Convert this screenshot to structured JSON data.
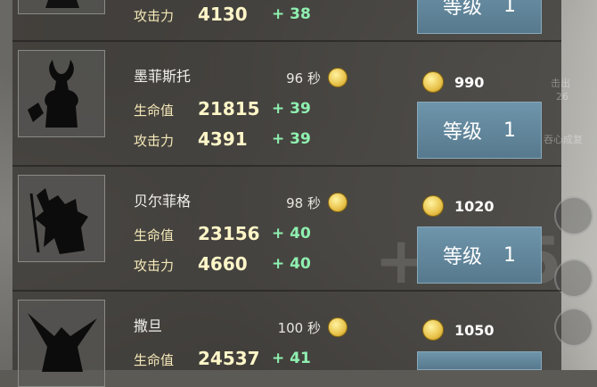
{
  "colors": {
    "panel": "#3a3834",
    "stat_value": "#fff6c8",
    "stat_plus": "#8ff0b0",
    "button": "#6e95ab"
  },
  "rows": [
    {
      "name": "",
      "time": "",
      "cost": "",
      "hp_label": "",
      "hp_value": "",
      "hp_plus": "",
      "atk_label": "攻击力",
      "atk_value": "4130",
      "atk_plus": "+ 38",
      "level_label": "等级",
      "level_value": "1"
    },
    {
      "name": "墨菲斯托",
      "time": "96 秒",
      "cost": "990",
      "hp_label": "生命值",
      "hp_value": "21815",
      "hp_plus": "+ 39",
      "atk_label": "攻击力",
      "atk_value": "4391",
      "atk_plus": "+ 39",
      "level_label": "等级",
      "level_value": "1"
    },
    {
      "name": "贝尔菲格",
      "time": "98 秒",
      "cost": "1020",
      "hp_label": "生命值",
      "hp_value": "23156",
      "hp_plus": "+ 40",
      "atk_label": "攻击力",
      "atk_value": "4660",
      "atk_plus": "+ 40",
      "level_label": "等级",
      "level_value": "1"
    },
    {
      "name": "撒旦",
      "time": "100 秒",
      "cost": "1050",
      "hp_label": "生命值",
      "hp_value": "24537",
      "hp_plus": "+ 41",
      "atk_label": "",
      "atk_value": "",
      "atk_plus": "",
      "level_label": "",
      "level_value": ""
    }
  ],
  "background_text": {
    "deco1": "击出",
    "deco2": "26",
    "deco3": "吞心成复",
    "big": "+125"
  }
}
